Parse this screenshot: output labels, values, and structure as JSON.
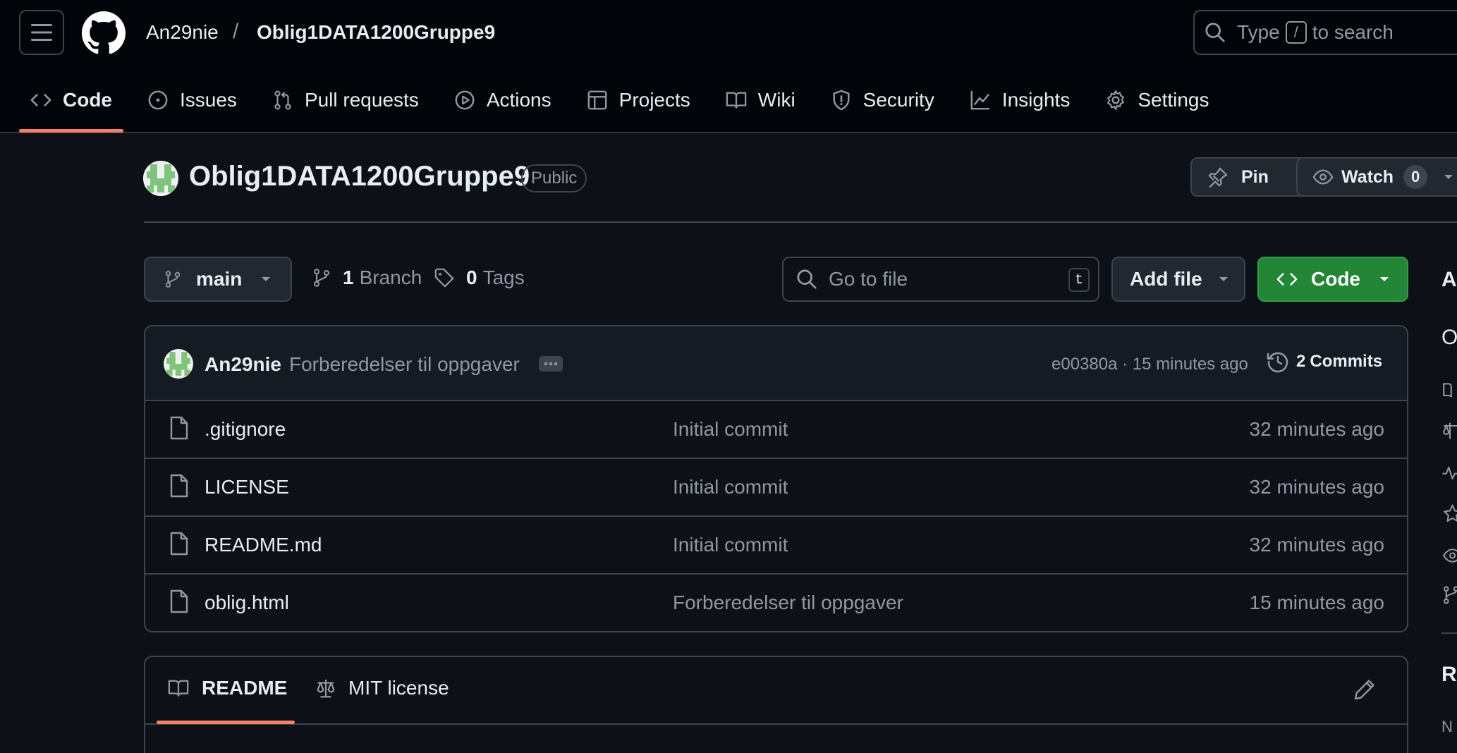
{
  "header": {
    "owner": "An29nie",
    "separator": "/",
    "repo": "Oblig1DATA1200Gruppe9",
    "search": {
      "prefix": "Type",
      "key": "/",
      "suffix": "to search"
    }
  },
  "nav_tabs": [
    {
      "label": "Code",
      "icon": "code-icon",
      "active": true
    },
    {
      "label": "Issues",
      "icon": "issue-icon"
    },
    {
      "label": "Pull requests",
      "icon": "pull-request-icon"
    },
    {
      "label": "Actions",
      "icon": "play-icon"
    },
    {
      "label": "Projects",
      "icon": "table-icon"
    },
    {
      "label": "Wiki",
      "icon": "book-icon"
    },
    {
      "label": "Security",
      "icon": "shield-icon"
    },
    {
      "label": "Insights",
      "icon": "graph-icon"
    },
    {
      "label": "Settings",
      "icon": "gear-icon"
    }
  ],
  "repo_header": {
    "title": "Oblig1DATA1200Gruppe9",
    "visibility": "Public",
    "pin_label": "Pin",
    "watch_label": "Watch",
    "watch_count": "0"
  },
  "toolbar": {
    "branch": "main",
    "branch_count": "1",
    "branch_label": "Branch",
    "tag_count": "0",
    "tag_label": "Tags",
    "goto_placeholder": "Go to file",
    "goto_key": "t",
    "add_file": "Add file",
    "code_button": "Code"
  },
  "latest_commit": {
    "author": "An29nie",
    "message": "Forberedelser til oppgaver",
    "sha_time": "e00380a · 15 minutes ago",
    "commits_count": "2",
    "commits_label": "Commits"
  },
  "files": [
    {
      "name": ".gitignore",
      "message": "Initial commit",
      "time": "32 minutes ago"
    },
    {
      "name": "LICENSE",
      "message": "Initial commit",
      "time": "32 minutes ago"
    },
    {
      "name": "README.md",
      "message": "Initial commit",
      "time": "32 minutes ago"
    },
    {
      "name": "oblig.html",
      "message": "Forberedelser til oppgaver",
      "time": "15 minutes ago"
    }
  ],
  "readme_tabs": [
    {
      "label": "README",
      "icon": "book-icon",
      "active": true
    },
    {
      "label": "MIT license",
      "icon": "law-icon"
    }
  ],
  "sidebar_partial": {
    "about_initial": "A",
    "desc_initial": "O",
    "releases_initial": "R",
    "no_initial": "N"
  },
  "colors": {
    "accent_underline": "#f78166",
    "code_button": "#238636",
    "avatar_green": "#7fc47a"
  }
}
